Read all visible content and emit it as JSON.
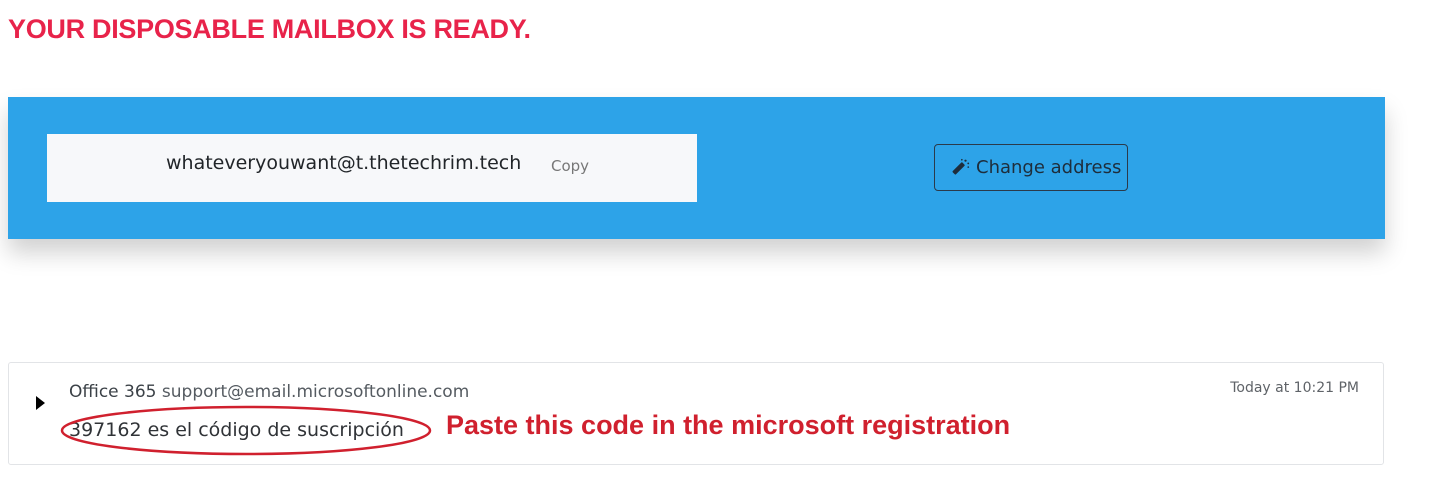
{
  "header": {
    "title": "YOUR DISPOSABLE MAILBOX IS READY."
  },
  "mailbox": {
    "address": "whateveryouwant@t.thetechrim.tech",
    "copy_label": "Copy",
    "change_address_label": "Change address"
  },
  "message": {
    "sender_name": "Office 365",
    "sender_email": "support@email.microsoftonline.com",
    "time": "Today at 10:21 PM",
    "subject": "397162 es el código de suscripción"
  },
  "annotation": {
    "text": "Paste this code in the microsoft registration"
  },
  "icons": {
    "change_address": "magic-wand-icon",
    "expand": "caret-right-icon"
  },
  "colors": {
    "title": "#e8234a",
    "banner": "#2da3e8",
    "annotation": "#d0202e"
  }
}
